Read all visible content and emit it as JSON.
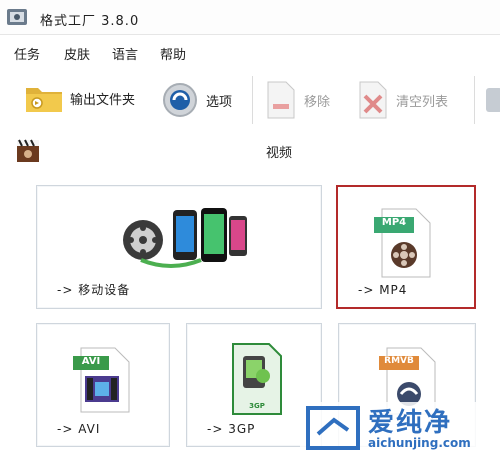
{
  "window": {
    "title": "格式工厂 3.8.0"
  },
  "menu": [
    "任务",
    "皮肤",
    "语言",
    "帮助"
  ],
  "toolbar": {
    "output_folder": "输出文件夹",
    "options": "选项",
    "remove": "移除",
    "clear_list": "清空列表"
  },
  "section": {
    "label": "视频"
  },
  "tiles": [
    {
      "caption": "-> 移动设备"
    },
    {
      "caption": "-> MP4",
      "badge": "MP4"
    },
    {
      "caption": "-> AVI",
      "badge": "AVI"
    },
    {
      "caption": "-> 3GP",
      "badge": "3GP"
    },
    {
      "badge": "RMVB"
    }
  ],
  "watermark": {
    "name": "爱纯净",
    "url": "aichunjing.com"
  },
  "colors": {
    "selected_border": "#b32a2a",
    "watermark_blue": "#2f6fbf"
  }
}
